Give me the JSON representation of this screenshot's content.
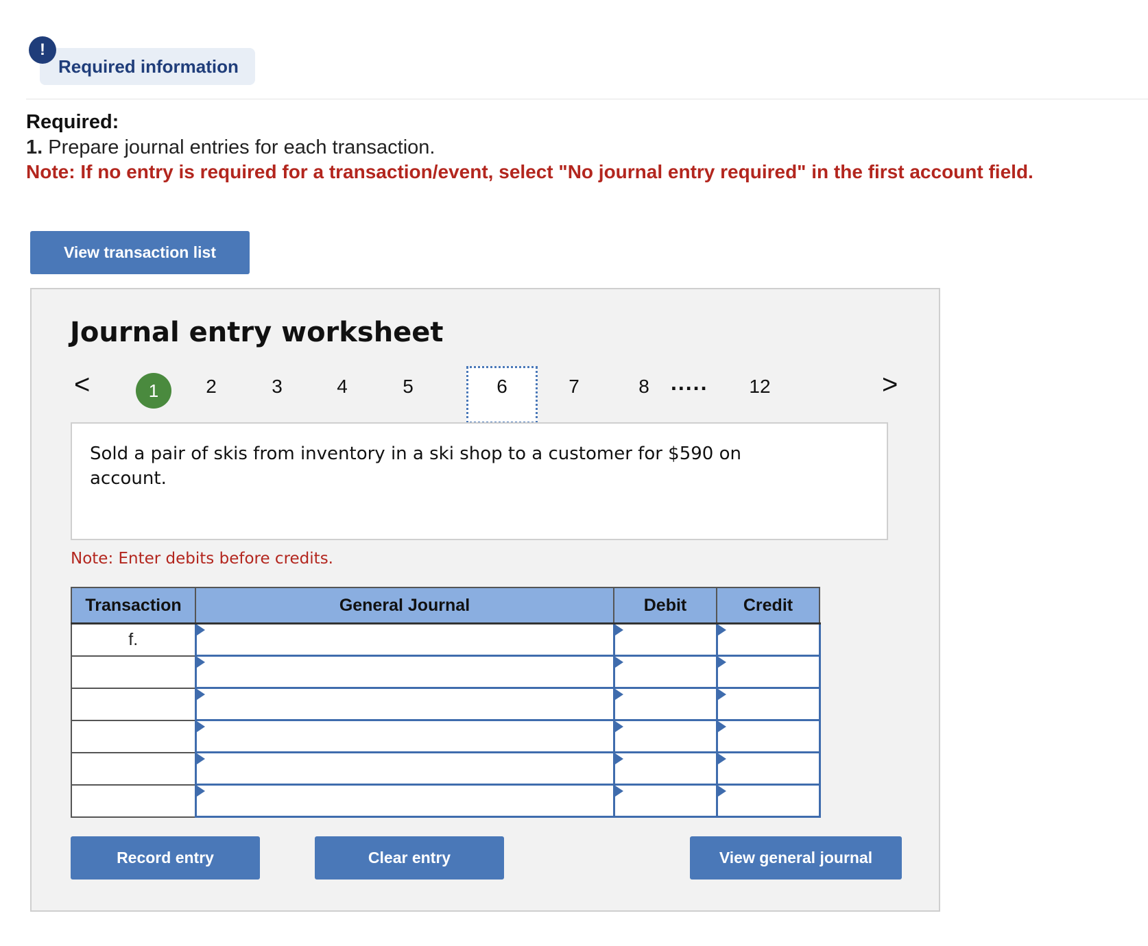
{
  "header": {
    "required_info_label": "Required information",
    "alert_glyph": "!"
  },
  "instructions": {
    "required_title": "Required:",
    "item_number": "1.",
    "item_text": "Prepare journal entries for each transaction.",
    "note": "Note: If no entry is required for a transaction/event, select \"No journal entry required\" in the first account field."
  },
  "buttons": {
    "view_transaction_list": "View transaction list",
    "record_entry": "Record entry",
    "clear_entry": "Clear entry",
    "view_general_journal": "View general journal"
  },
  "worksheet": {
    "title": "Journal entry worksheet",
    "nav": {
      "prev": "<",
      "next": ">",
      "active": "1",
      "items": [
        "2",
        "3",
        "4",
        "5",
        "6",
        "7",
        "8",
        "12"
      ],
      "ellipsis": "....."
    },
    "description": "Sold a pair of skis from inventory in a ski shop to a customer for $590 on account.",
    "debit_note": "Note: Enter debits before credits.",
    "table": {
      "headers": {
        "transaction": "Transaction",
        "general_journal": "General Journal",
        "debit": "Debit",
        "credit": "Credit"
      },
      "rows": [
        {
          "transaction": "f.",
          "account": "",
          "debit": "",
          "credit": ""
        },
        {
          "transaction": "",
          "account": "",
          "debit": "",
          "credit": ""
        },
        {
          "transaction": "",
          "account": "",
          "debit": "",
          "credit": ""
        },
        {
          "transaction": "",
          "account": "",
          "debit": "",
          "credit": ""
        },
        {
          "transaction": "",
          "account": "",
          "debit": "",
          "credit": ""
        },
        {
          "transaction": "",
          "account": "",
          "debit": "",
          "credit": ""
        }
      ]
    }
  },
  "colors": {
    "button_blue": "#4a78b8",
    "header_blue": "#8aaee0",
    "active_green": "#4a8a3e",
    "note_red": "#b3261e",
    "alert_navy": "#1f3d7a"
  }
}
